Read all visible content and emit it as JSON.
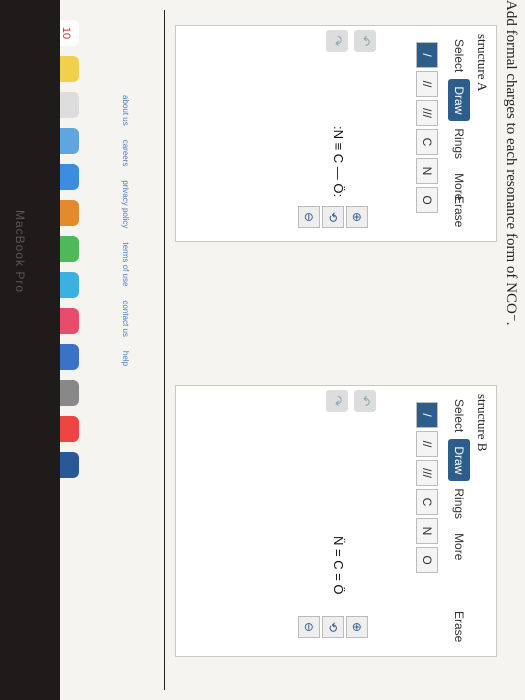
{
  "question": "Add formal charges to each resonance form of NCO⁻.",
  "structures": [
    {
      "title": "structure A",
      "tools": [
        "Select",
        "Draw",
        "Rings",
        "More"
      ],
      "erase_label": "Erase",
      "bonds": [
        "/",
        "//",
        "///"
      ],
      "atoms": [
        "C",
        "N",
        "O"
      ],
      "molecule": ":N ≡ C — Ö:"
    },
    {
      "title": "structure B",
      "tools": [
        "Select",
        "Draw",
        "Rings",
        "More"
      ],
      "erase_label": "Erase",
      "bonds": [
        "/",
        "//",
        "///"
      ],
      "atoms": [
        "C",
        "N",
        "O"
      ],
      "molecule": "N̈ = C = Ö"
    }
  ],
  "footer_links": [
    "about us",
    "careers",
    "privacy policy",
    "terms of use",
    "contact us",
    "help"
  ],
  "dock": {
    "calendar_day": "10"
  },
  "laptop_brand": "MacBook Pro",
  "colors": {
    "accent": "#2d5d8a",
    "link": "#4a7cbf"
  }
}
